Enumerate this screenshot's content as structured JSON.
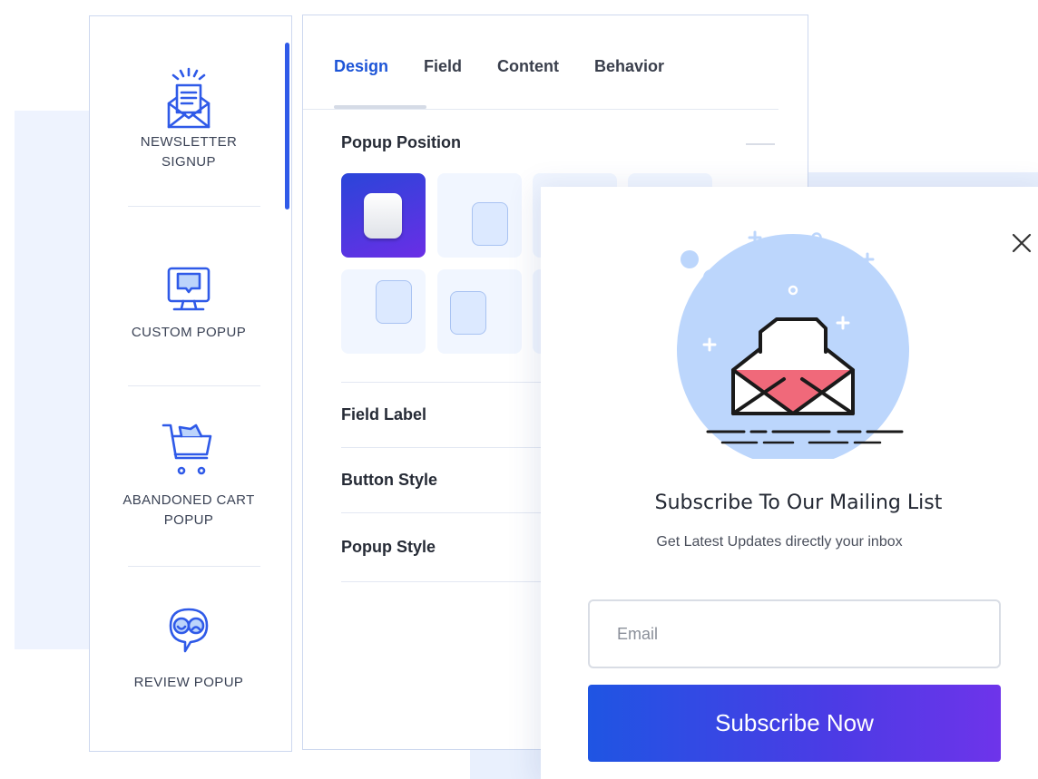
{
  "sidebar": {
    "items": [
      {
        "label_1": "NEWSLETTER",
        "label_2": "SIGNUP",
        "icon": "newsletter-icon"
      },
      {
        "label_1": "CUSTOM POPUP",
        "icon": "monitor-icon"
      },
      {
        "label_1": "ABANDONED CART",
        "label_2": "POPUP",
        "icon": "cart-icon"
      },
      {
        "label_1": "REVIEW POPUP",
        "icon": "review-icon"
      }
    ]
  },
  "panel": {
    "tabs": [
      {
        "label": "Design",
        "active": true
      },
      {
        "label": "Field"
      },
      {
        "label": "Content"
      },
      {
        "label": "Behavior"
      }
    ],
    "popup_position": {
      "title": "Popup Position",
      "selected_index": 0
    },
    "sections": [
      {
        "label": "Field Label"
      },
      {
        "label": "Button Style"
      },
      {
        "label": "Popup Style"
      }
    ]
  },
  "popup": {
    "title": "Subscribe To Our Mailing List",
    "subtitle": "Get Latest Updates directly your inbox",
    "email_placeholder": "Email",
    "button_label": "Subscribe Now",
    "close_icon": "close-icon",
    "colors": {
      "accent": "#1d55d7",
      "button_start": "#1f55e3",
      "button_end": "#6e34ea",
      "envelope_red": "#f0697a"
    }
  }
}
